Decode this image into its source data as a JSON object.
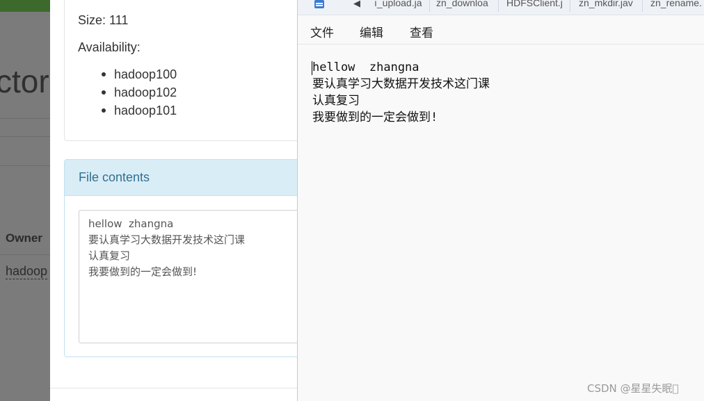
{
  "background": {
    "title_fragment": "ctor",
    "owner_header": "Owner",
    "owner_value": "hadoop"
  },
  "file_info": {
    "size_line": "Size: 111",
    "availability_label": "Availability:",
    "availability": [
      "hadoop100",
      "hadoop102",
      "hadoop101"
    ]
  },
  "file_contents": {
    "title": "File contents",
    "text": "hellow  zhangna\n要认真学习大数据开发技术这门课\n认真复习\n我要做到的一定会做到!"
  },
  "notepad": {
    "tabs": [
      "ı_upload.ja",
      "zn_downloa",
      "HDFSClient.j",
      "zn_mkdir.jav",
      "zn_rename."
    ],
    "menu": [
      "文件",
      "编辑",
      "查看"
    ],
    "editor_text": "hellow  zhangna\n要认真学习大数据开发技术这门课\n认真复习\n我要做到的一定会做到!"
  },
  "watermark": "CSDN @星星失眠\u0000",
  "icons": {
    "app": "notepad-document-icon",
    "tab_scroll": "triangle-left-icon"
  },
  "colors": {
    "panel_header_bg": "#d9edf7",
    "panel_header_text": "#31708f",
    "dim_overlay": "#7b7b7b",
    "nav_green": "#3d6a2c"
  }
}
